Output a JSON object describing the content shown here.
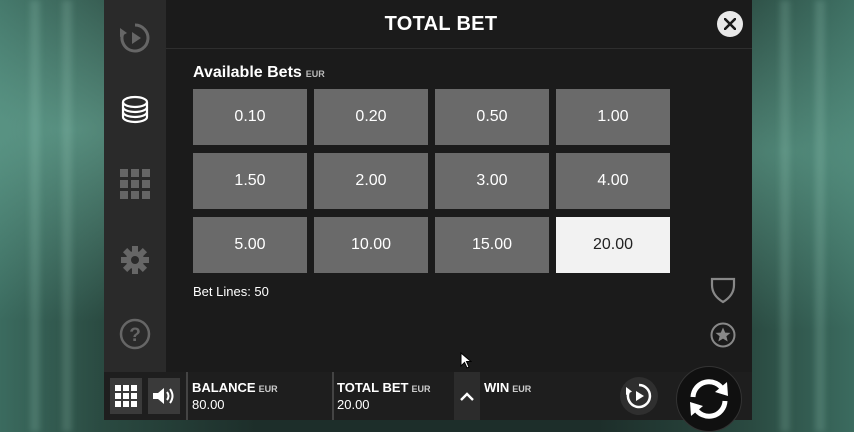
{
  "dialog": {
    "title": "TOTAL BET",
    "available_bets_label": "Available Bets",
    "currency": "EUR",
    "bets": [
      "0.10",
      "0.20",
      "0.50",
      "1.00",
      "1.50",
      "2.00",
      "3.00",
      "4.00",
      "5.00",
      "10.00",
      "15.00",
      "20.00"
    ],
    "selected_bet": "20.00",
    "bet_lines": "Bet Lines: 50"
  },
  "sidebar": {
    "items": [
      {
        "icon": "autoplay-icon"
      },
      {
        "icon": "coins-icon",
        "active": true
      },
      {
        "icon": "paytable-grid-icon"
      },
      {
        "icon": "gear-icon"
      },
      {
        "icon": "help-icon"
      }
    ]
  },
  "bottom_bar": {
    "balance_label": "BALANCE",
    "balance_currency": "EUR",
    "balance_value": "80.00",
    "total_bet_label": "TOTAL BET",
    "total_bet_currency": "EUR",
    "total_bet_value": "20.00",
    "win_label": "WIN",
    "win_currency": "EUR"
  },
  "colors": {
    "panel": "#1b1b1b",
    "bet_button": "#6a6a6a",
    "bet_selected": "#f2f2f2",
    "accent": "#ffffff"
  }
}
